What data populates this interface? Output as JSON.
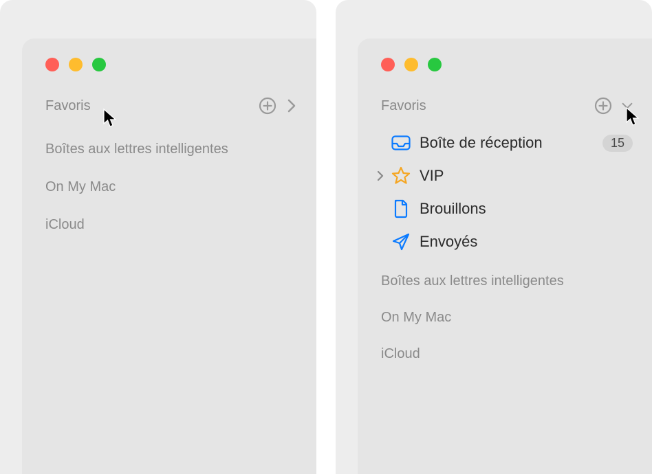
{
  "left": {
    "sections": {
      "favorites": "Favoris",
      "smart": "Boîtes aux lettres intelligentes",
      "local": "On My Mac",
      "icloud": "iCloud"
    }
  },
  "right": {
    "sections": {
      "favorites": "Favoris",
      "smart": "Boîtes aux lettres intelligentes",
      "local": "On My Mac",
      "icloud": "iCloud"
    },
    "favorites_items": {
      "inbox": {
        "label": "Boîte de réception",
        "count": "15"
      },
      "vip": {
        "label": "VIP"
      },
      "drafts": {
        "label": "Brouillons"
      },
      "sent": {
        "label": "Envoyés"
      }
    }
  }
}
